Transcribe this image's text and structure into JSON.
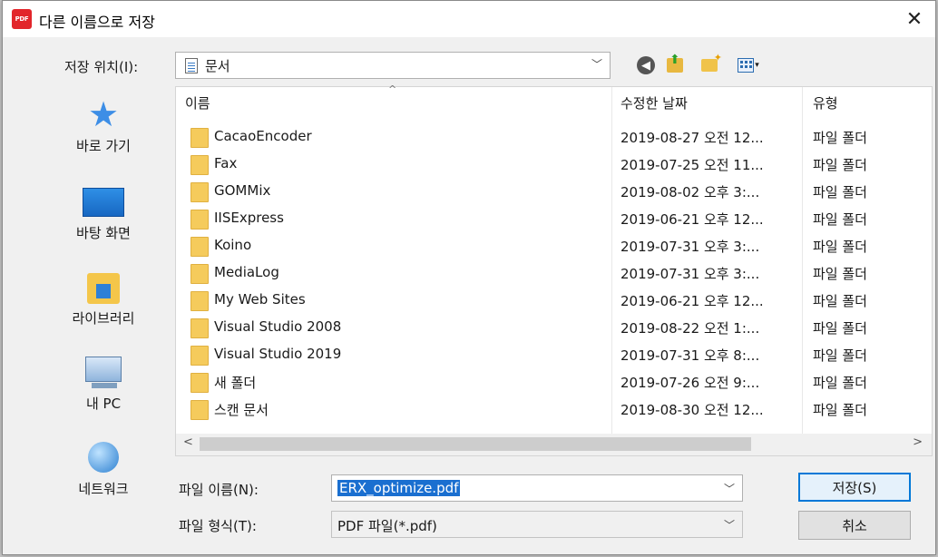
{
  "window": {
    "title": "다른 이름으로 저장",
    "app_icon_text": "PDF",
    "close_glyph": "✕"
  },
  "location": {
    "label": "저장 위치(I):",
    "value": "문서",
    "dropdown_glyph": "﹀"
  },
  "toolbar": {
    "back_glyph": "◀",
    "view_arrow": "▾"
  },
  "places": [
    {
      "label": "바로 가기",
      "icon": "star-icon"
    },
    {
      "label": "바탕 화면",
      "icon": "desktop-icon"
    },
    {
      "label": "라이브러리",
      "icon": "library-icon"
    },
    {
      "label": "내 PC",
      "icon": "pc-icon"
    },
    {
      "label": "네트워크",
      "icon": "network-icon"
    }
  ],
  "columns": {
    "name": "이름",
    "date": "수정한 날짜",
    "type": "유형",
    "sort_glyph": "^"
  },
  "files": [
    {
      "name": "CacaoEncoder",
      "date": "2019-08-27 오전 12...",
      "type": "파일 폴더"
    },
    {
      "name": "Fax",
      "date": "2019-07-25 오전 11...",
      "type": "파일 폴더"
    },
    {
      "name": "GOMMix",
      "date": "2019-08-02 오후 3:...",
      "type": "파일 폴더"
    },
    {
      "name": "IISExpress",
      "date": "2019-06-21 오후 12...",
      "type": "파일 폴더"
    },
    {
      "name": "Koino",
      "date": "2019-07-31 오후 3:...",
      "type": "파일 폴더"
    },
    {
      "name": "MediaLog",
      "date": "2019-07-31 오후 3:...",
      "type": "파일 폴더"
    },
    {
      "name": "My Web Sites",
      "date": "2019-06-21 오후 12...",
      "type": "파일 폴더"
    },
    {
      "name": "Visual Studio 2008",
      "date": "2019-08-22 오전 1:...",
      "type": "파일 폴더"
    },
    {
      "name": "Visual Studio 2019",
      "date": "2019-07-31 오후 8:...",
      "type": "파일 폴더"
    },
    {
      "name": "새 폴더",
      "date": "2019-07-26 오전 9:...",
      "type": "파일 폴더"
    },
    {
      "name": "스캔 문서",
      "date": "2019-08-30 오전 12...",
      "type": "파일 폴더"
    }
  ],
  "scrollbar": {
    "left_glyph": "<",
    "right_glyph": ">"
  },
  "filename": {
    "label": "파일 이름(N):",
    "value": "ERX_optimize.pdf",
    "dropdown_glyph": "﹀"
  },
  "filetype": {
    "label": "파일 형식(T):",
    "value": "PDF 파일(*.pdf)",
    "dropdown_glyph": "﹀"
  },
  "buttons": {
    "save": "저장(S)",
    "cancel": "취소"
  },
  "colors": {
    "accent": "#0078d7",
    "selection": "#1a6fd0",
    "folder": "#f5cb5c",
    "app_icon": "#e2262b"
  }
}
